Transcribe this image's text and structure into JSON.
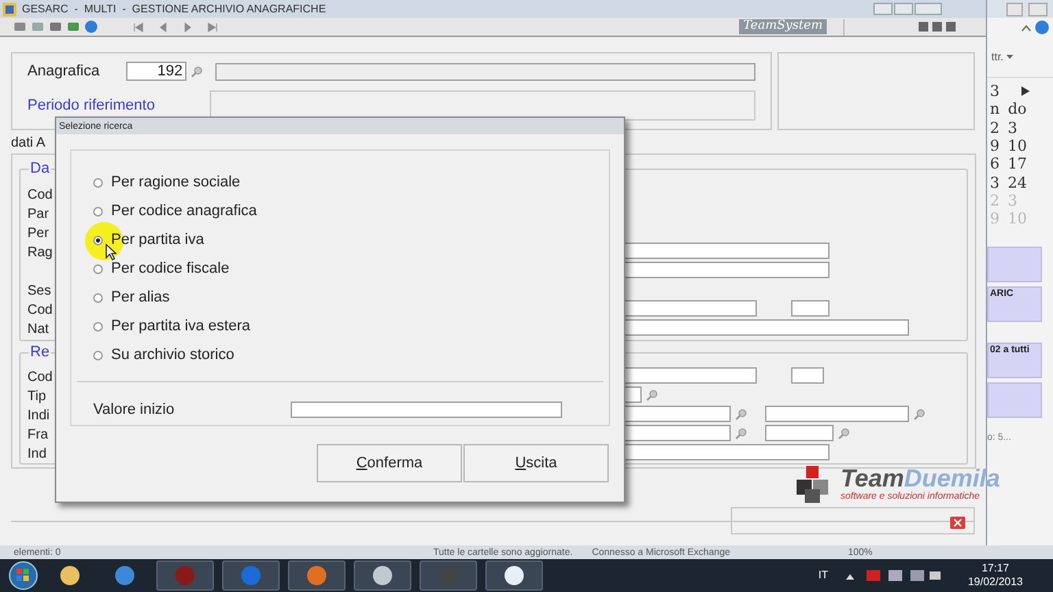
{
  "window": {
    "title": "GESARC  -  MULTI  -  GESTIONE ARCHIVIO ANAGRAFICHE",
    "brand": "TeamSystem"
  },
  "header": {
    "anagrafica_label": "Anagrafica",
    "anagrafica_value": "192",
    "periodo_label": "Periodo riferimento"
  },
  "tab_label": "dati A",
  "sections": [
    {
      "legend": "Da",
      "labels": [
        "Cod",
        "Par",
        "Per",
        "Rag",
        "Ses",
        "Cod",
        "Nat"
      ]
    },
    {
      "legend": "Re",
      "labels": [
        "Cod",
        "Tip",
        "Indi",
        "Fra",
        "Ind"
      ]
    }
  ],
  "logo": {
    "part1": "Team",
    "part2": "Duemila",
    "tagline": "software e soluzioni informatiche"
  },
  "dialog": {
    "title": "Selezione ricerca",
    "options": [
      {
        "label": "Per ragione sociale",
        "selected": false
      },
      {
        "label": "Per codice anagrafica",
        "selected": false
      },
      {
        "label": "Per partita iva",
        "selected": true
      },
      {
        "label": "Per codice fiscale",
        "selected": false
      },
      {
        "label": "Per alias",
        "selected": false
      },
      {
        "label": "Per partita iva estera",
        "selected": false
      },
      {
        "label": "Su archivio storico",
        "selected": false
      }
    ],
    "start_label": "Valore inizio",
    "buttons": [
      "Conferma",
      "Uscita"
    ]
  },
  "side_window": {
    "menu": "ttr.",
    "calendar": [
      {
        "cells": [
          "3"
        ],
        "dim": false
      },
      {
        "cells": [
          "n",
          "do"
        ],
        "dim": false
      },
      {
        "cells": [
          "2",
          "3"
        ],
        "dim": false
      },
      {
        "cells": [
          "9",
          "10"
        ],
        "dim": false
      },
      {
        "cells": [
          "6",
          "17"
        ],
        "dim": false
      },
      {
        "cells": [
          "3",
          "24"
        ],
        "dim": false
      },
      {
        "cells": [
          "2",
          "3"
        ],
        "dim": true
      },
      {
        "cells": [
          "9",
          "10"
        ],
        "dim": true
      }
    ],
    "events": [
      "ARIC",
      "02 a tutti"
    ],
    "note": "o: 5..."
  },
  "status_bar": [
    "elementi: 0",
    "Tutte le cartelle sono aggiornate.",
    "Connesso a Microsoft Exchange",
    "100%"
  ],
  "taskbar": {
    "language": "IT",
    "time": "17:17",
    "date": "19/02/2013"
  }
}
